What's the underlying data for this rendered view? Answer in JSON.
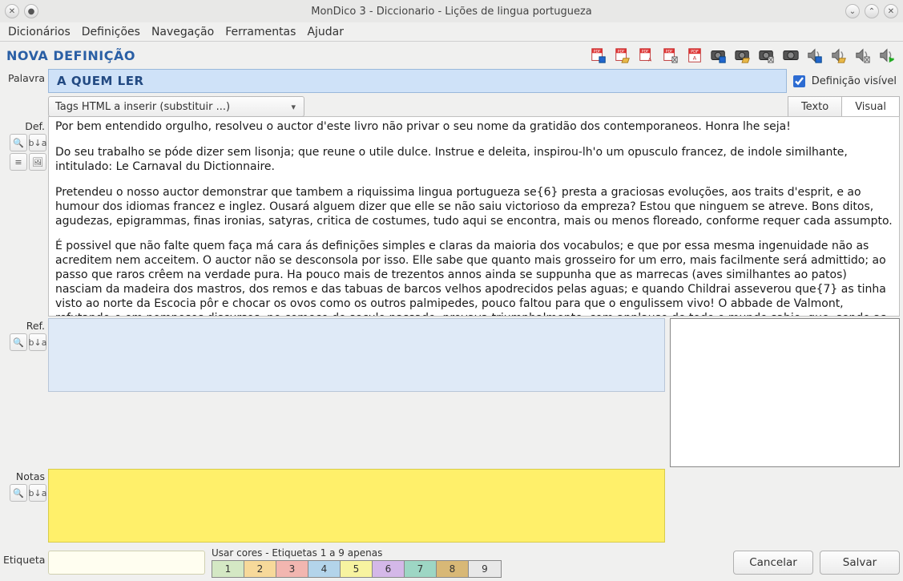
{
  "window": {
    "title": "MonDico 3 - Diccionario - Lições de lingua portugueza"
  },
  "menubar": [
    "Dicionários",
    "Definições",
    "Navegação",
    "Ferramentas",
    "Ajudar"
  ],
  "header": {
    "title": "NOVA DEFINIÇÃO"
  },
  "toolbar_icons": [
    "pdf-save-icon",
    "pdf-open-icon",
    "pdf-export-icon",
    "pdf-delete-icon",
    "pdf-plain-icon",
    "camera-save-icon",
    "camera-open-icon",
    "camera-delete-icon",
    "camera-plain-icon",
    "speaker-save-icon",
    "speaker-open-icon",
    "speaker-delete-icon",
    "speaker-go-icon"
  ],
  "labels": {
    "palavra": "Palavra",
    "def": "Def.",
    "ref": "Ref.",
    "notas": "Notas",
    "etiqueta": "Etiqueta",
    "visible": "Definição visível",
    "tags_combo": "Tags HTML a inserir (substituir ...)",
    "tab_texto": "Texto",
    "tab_visual": "Visual",
    "colors_label": "Usar cores - Etiquetas 1 a 9 apenas",
    "cancel": "Cancelar",
    "save": "Salvar"
  },
  "word": "A QUEM LER",
  "definition_paragraphs": [
    "Por bem entendido orgulho, resolveu o auctor d'este livro não privar o seu nome da gratidão dos contemporaneos. Honra lhe seja!",
    "Do seu trabalho se póde dizer sem lisonja; que reune o utile dulce. Instrue e deleita, inspirou-lh'o um opusculo francez, de indole similhante, intitulado: Le Carnaval du Dictionnaire.",
    "Pretendeu o nosso auctor demonstrar que tambem a riquissima lingua portugueza se{6} presta a graciosas evoluções, aos traits d'esprit, e ao humour dos idiomas francez e inglez. Ousará alguem dizer que elle se não saiu victorioso da empreza? Estou que ninguem se atreve. Bons ditos, agudezas, epigrammas, finas ironias, satyras, critica de costumes, tudo aqui se encontra, mais ou menos floreado, conforme requer cada assumpto.",
    "É possivel que não falte quem faça má cara ás definições simples e claras da maioria dos vocabulos; e que por essa mesma ingenuidade não as acreditem nem acceitem. O auctor não se desconsola por isso. Elle sabe que quanto mais grosseiro for um erro, mais facilmente será admittido; ao passo que raros crêem na verdade pura. Ha pouco mais de trezentos annos ainda se suppunha que as marrecas (aves similhantes ao patos) nasciam da madeira dos mastros, dos remos e das tabuas de barcos velhos apodrecidos pelas aguas; e quando Childrai asseverou que{7} as tinha visto ao norte da Escocia pôr e chocar os ovos como os outros palmipedes, pouco faltou para que o engulissem vivo! O abbade de Valmont, refutando-o em pomposos discursos, no começo do seculo passado, provava triumphalmente, com applauso de todo o mundo sabio, que, sendo as marrecas «animaes de sangue frio, como os peixes, não podiam chocar», e que as"
  ],
  "colors": [
    {
      "n": "1",
      "bg": "#d4e8c4"
    },
    {
      "n": "2",
      "bg": "#f7d99a"
    },
    {
      "n": "3",
      "bg": "#f2b6b0"
    },
    {
      "n": "4",
      "bg": "#b3d4ea"
    },
    {
      "n": "5",
      "bg": "#f7f3a0"
    },
    {
      "n": "6",
      "bg": "#d4b8e8"
    },
    {
      "n": "7",
      "bg": "#9dd6c4"
    },
    {
      "n": "8",
      "bg": "#d8b876"
    },
    {
      "n": "9",
      "bg": "#e8e8e8"
    }
  ]
}
